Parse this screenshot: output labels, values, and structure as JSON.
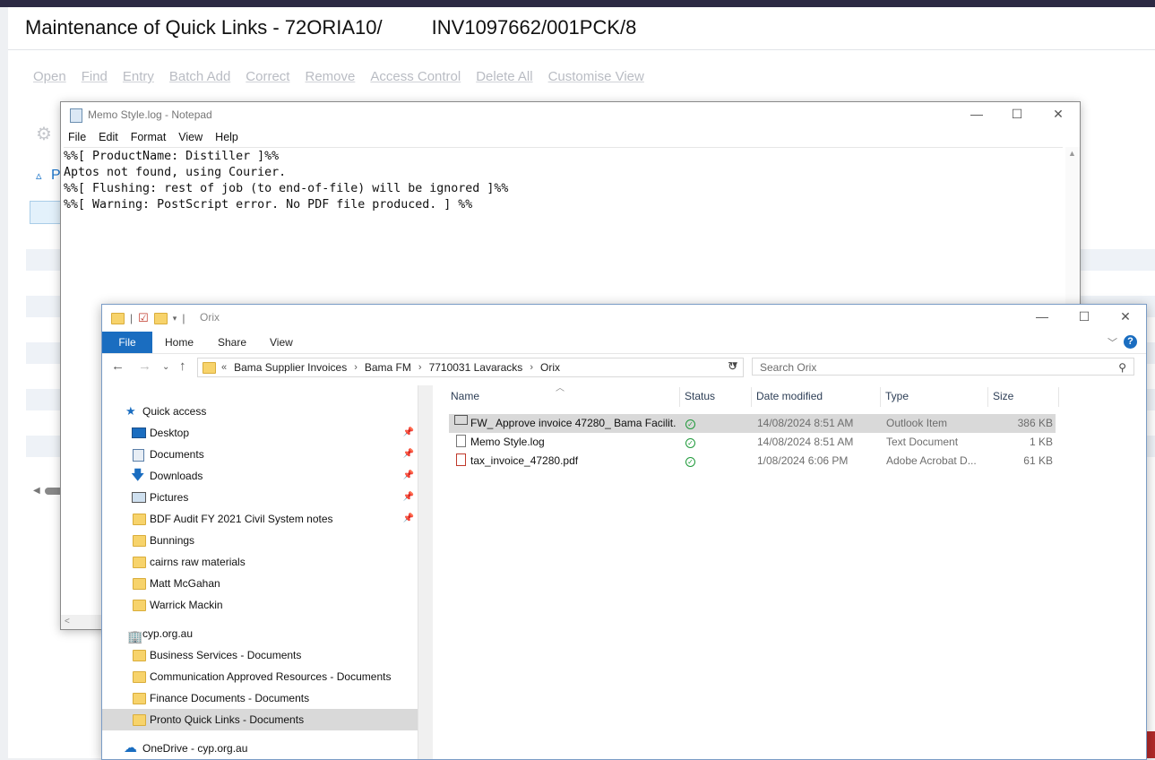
{
  "app": {
    "title": "Maintenance of Quick Links - 72ORIA10/         INV1097662/001PCK/8",
    "toolbar": [
      "Open",
      "Find",
      "Entry",
      "Batch Add",
      "Correct",
      "Remove",
      "Access Control",
      "Delete All",
      "Customise View"
    ],
    "section_letter": "P"
  },
  "notepad": {
    "title": "Memo Style.log - Notepad",
    "menu": [
      "File",
      "Edit",
      "Format",
      "View",
      "Help"
    ],
    "lines": [
      "%%[ ProductName: Distiller ]%%",
      "Aptos not found, using Courier.",
      "%%[ Flushing: rest of job (to end-of-file) will be ignored ]%%",
      "%%[ Warning: PostScript error. No PDF file produced. ] %%"
    ]
  },
  "explorer": {
    "title": "Orix",
    "ribbon_tabs": [
      "File",
      "Home",
      "Share",
      "View"
    ],
    "address": [
      "Bama Supplier Invoices",
      "Bama FM",
      "7710031 Lavaracks",
      "Orix"
    ],
    "search_placeholder": "Search Orix",
    "nav": {
      "quick_access_label": "Quick access",
      "quick_access": [
        {
          "label": "Desktop",
          "icon": "desktop-icon",
          "pinned": true
        },
        {
          "label": "Documents",
          "icon": "documents-icon",
          "pinned": true
        },
        {
          "label": "Downloads",
          "icon": "downloads-icon",
          "pinned": true
        },
        {
          "label": "Pictures",
          "icon": "pictures-icon",
          "pinned": true
        },
        {
          "label": "BDF Audit FY 2021 Civil System notes",
          "icon": "folder-icon",
          "pinned": true
        },
        {
          "label": "Bunnings",
          "icon": "folder-icon",
          "pinned": false
        },
        {
          "label": "cairns raw materials",
          "icon": "folder-icon",
          "pinned": false
        },
        {
          "label": "Matt McGahan",
          "icon": "folder-icon",
          "pinned": false
        },
        {
          "label": "Warrick Mackin",
          "icon": "folder-icon",
          "pinned": false
        }
      ],
      "org_label": "cyp.org.au",
      "org_items": [
        "Business Services - Documents",
        "Communication Approved Resources - Documents",
        "Finance Documents - Documents",
        "Pronto Quick Links - Documents"
      ],
      "onedrive_label": "OneDrive - cyp.org.au"
    },
    "columns": [
      "Name",
      "Status",
      "Date modified",
      "Type",
      "Size"
    ],
    "files": [
      {
        "name": "FW_ Approve invoice 47280_ Bama Facilit...",
        "date": "14/08/2024 8:51 AM",
        "type": "Outlook Item",
        "size": "386 KB",
        "icon": "mail-icon"
      },
      {
        "name": "Memo Style.log",
        "date": "14/08/2024 8:51 AM",
        "type": "Text Document",
        "size": "1 KB",
        "icon": "text-file-icon"
      },
      {
        "name": "tax_invoice_47280.pdf",
        "date": "1/08/2024 6:06 PM",
        "type": "Adobe Acrobat D...",
        "size": "61 KB",
        "icon": "pdf-icon"
      }
    ]
  },
  "colors": {
    "accent": "#1a6dc0",
    "top_bar": "#2c2a44",
    "status_ok": "#1f9a3a"
  }
}
